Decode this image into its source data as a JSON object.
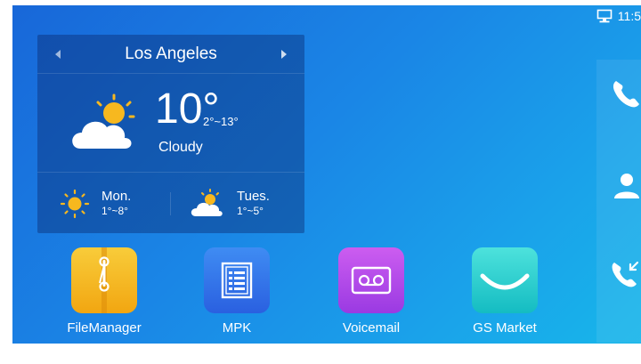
{
  "status_bar": {
    "time": "11:5",
    "network_icon": "ethernet-icon"
  },
  "weather": {
    "city": "Los Angeles",
    "temperature": "10°",
    "range": "2°~13°",
    "condition": "Cloudy",
    "icons": {
      "current": "partly-cloudy-icon"
    },
    "forecast": [
      {
        "day": "Mon.",
        "range": "1°~8°",
        "icon": "sun-icon"
      },
      {
        "day": "Tues.",
        "range": "1°~5°",
        "icon": "partly-cloudy-icon"
      }
    ]
  },
  "apps": [
    {
      "label": "FileManager",
      "icon": "file-manager-icon",
      "color": "#f5b622"
    },
    {
      "label": "MPK",
      "icon": "mpk-icon",
      "color": "#3273ea"
    },
    {
      "label": "Voicemail",
      "icon": "voicemail-icon",
      "color": "#b24ae8"
    },
    {
      "label": "GS Market",
      "icon": "gs-market-icon",
      "color": "#2bcccc"
    }
  ],
  "dock": [
    {
      "icon": "phone-icon"
    },
    {
      "icon": "contacts-icon"
    },
    {
      "icon": "call-history-icon"
    }
  ]
}
